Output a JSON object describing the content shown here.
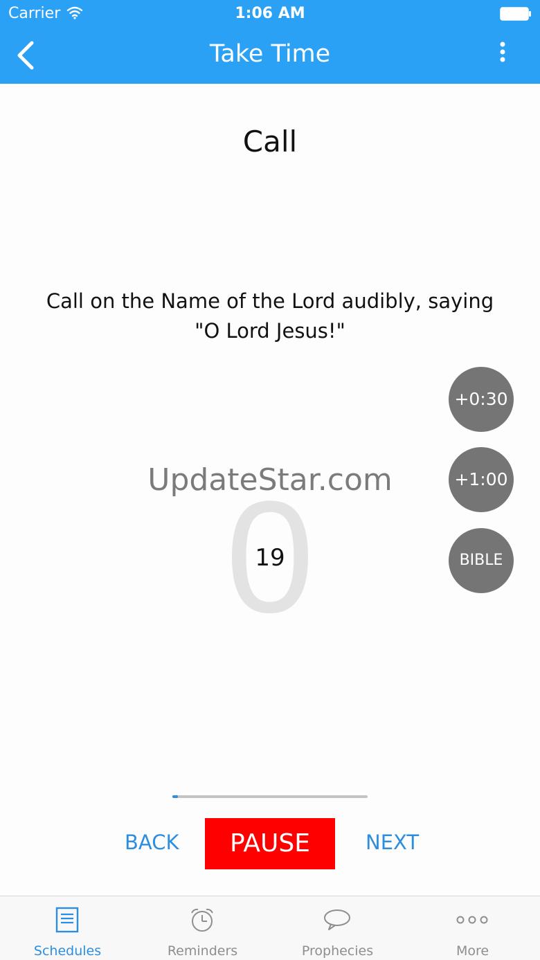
{
  "status_bar": {
    "carrier": "Carrier",
    "time": "1:06 AM",
    "wifi_icon": "wifi-icon",
    "battery_icon": "battery-icon"
  },
  "nav": {
    "title": "Take Time",
    "back_icon": "chevron-left-icon",
    "menu_icon": "vertical-ellipsis-icon"
  },
  "step": {
    "title": "Call",
    "instruction_line1": "Call on the Name of the Lord audibly, saying",
    "instruction_line2": "\"O Lord Jesus!\""
  },
  "timer": {
    "big_digit": "0",
    "count": "19",
    "watermark": "UpdateStar.com",
    "progress": 0.03
  },
  "side_buttons": {
    "add_30": "+0:30",
    "add_60": "+1:00",
    "bible": "BIBLE"
  },
  "controls": {
    "back": "BACK",
    "pause": "PAUSE",
    "next": "NEXT"
  },
  "tabs": [
    {
      "label": "Schedules",
      "icon": "schedule-list-icon",
      "active": true
    },
    {
      "label": "Reminders",
      "icon": "alarm-clock-icon",
      "active": false
    },
    {
      "label": "Prophecies",
      "icon": "speech-bubble-icon",
      "active": false
    },
    {
      "label": "More",
      "icon": "more-dots-icon",
      "active": false
    }
  ],
  "colors": {
    "accent": "#2aa1f5",
    "link": "#2d8ee0",
    "pause": "#ff0000",
    "circle": "#757575"
  }
}
